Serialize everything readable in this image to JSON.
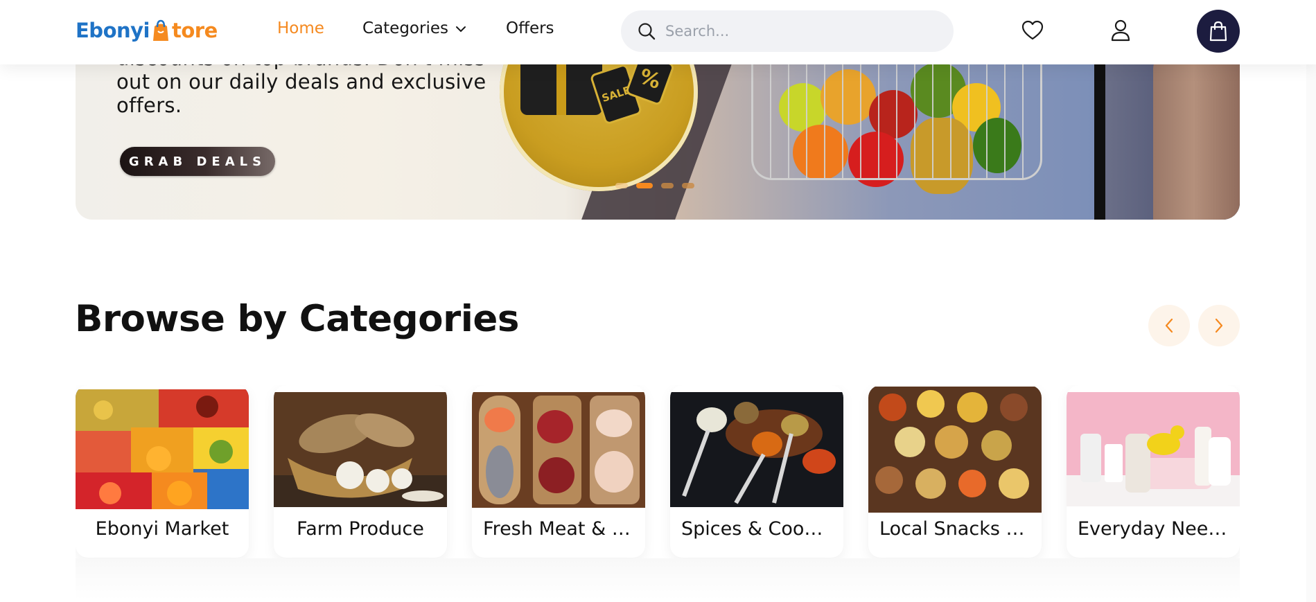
{
  "header": {
    "logo": {
      "part1": "Ebonyi",
      "part2": "tore"
    },
    "nav": {
      "home": "Home",
      "categories": "Categories",
      "offers": "Offers"
    },
    "search": {
      "placeholder": "Search..."
    },
    "icons": [
      "search-icon",
      "heart-icon",
      "user-icon",
      "shopping-bag-icon",
      "chevron-down-icon"
    ],
    "colors": {
      "accent": "#f5891f",
      "brand_blue": "#1f73c6",
      "cart_bg": "#1c1c3f"
    }
  },
  "hero": {
    "lines": [
      "discounts on top brands. Don't miss",
      "out on our daily deals and exclusive",
      "offers."
    ],
    "cta": "GRAB DEALS",
    "slides": {
      "count": 4,
      "active_index": 1
    }
  },
  "categories": {
    "title": "Browse by Categories",
    "items": [
      {
        "label": "Ebonyi Market"
      },
      {
        "label": "Farm Produce"
      },
      {
        "label": "Fresh Meat & Fish"
      },
      {
        "label": "Spices & Cooking"
      },
      {
        "label": "Local Snacks & Drinks"
      },
      {
        "label": "Everyday Needs"
      }
    ]
  }
}
